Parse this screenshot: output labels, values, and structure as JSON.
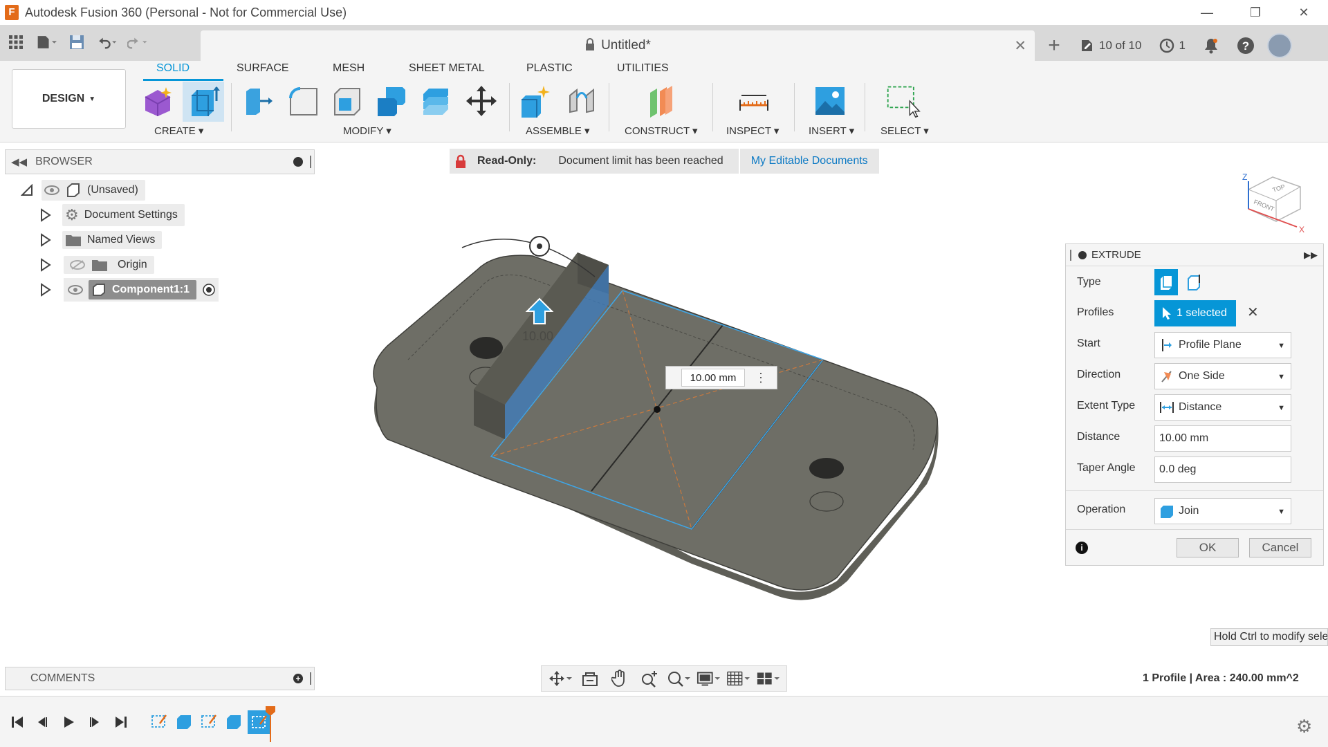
{
  "window": {
    "title": "Autodesk Fusion 360 (Personal - Not for Commercial Use)",
    "logo_letter": "F"
  },
  "tabstrip": {
    "doc_title": "Untitled*",
    "version_count": "10 of 10",
    "jobs_count": "1"
  },
  "toolbar": {
    "design_label": "DESIGN",
    "workspace_tabs": [
      "SOLID",
      "SURFACE",
      "MESH",
      "SHEET METAL",
      "PLASTIC",
      "UTILITIES"
    ],
    "groups": [
      "CREATE",
      "MODIFY",
      "ASSEMBLE",
      "CONSTRUCT",
      "INSPECT",
      "INSERT",
      "SELECT"
    ]
  },
  "browser": {
    "title": "BROWSER",
    "root": "(Unsaved)",
    "items": [
      "Document Settings",
      "Named Views",
      "Origin",
      "Component1:1"
    ]
  },
  "banner": {
    "readonly_label": "Read-Only:",
    "message": "Document limit has been reached",
    "link": "My Editable Documents"
  },
  "viewcube": {
    "top": "TOP",
    "front": "FRONT",
    "axis_x": "X",
    "axis_z": "Z"
  },
  "extrude": {
    "title": "EXTRUDE",
    "rows": {
      "type": "Type",
      "profiles": "Profiles",
      "start": "Start",
      "direction": "Direction",
      "extent_type": "Extent Type",
      "distance": "Distance",
      "taper_angle": "Taper Angle",
      "operation": "Operation"
    },
    "values": {
      "profiles_selected": "1 selected",
      "start": "Profile Plane",
      "direction": "One Side",
      "extent_type": "Distance",
      "distance": "10.00 mm",
      "taper_angle": "0.0 deg",
      "operation": "Join"
    },
    "ok_label": "OK",
    "cancel_label": "Cancel"
  },
  "viewport": {
    "dimension_value": "10.00 mm",
    "ghost_dimension": "10.00",
    "hint": "Hold Ctrl to modify sele",
    "status": "1 Profile | Area : 240.00 mm^2"
  },
  "comments": {
    "title": "COMMENTS"
  },
  "colors": {
    "accent": "#0696d7",
    "model_fill": "#6a6a63",
    "readonly_red": "#d83b3b",
    "link_blue": "#0b79c4"
  }
}
